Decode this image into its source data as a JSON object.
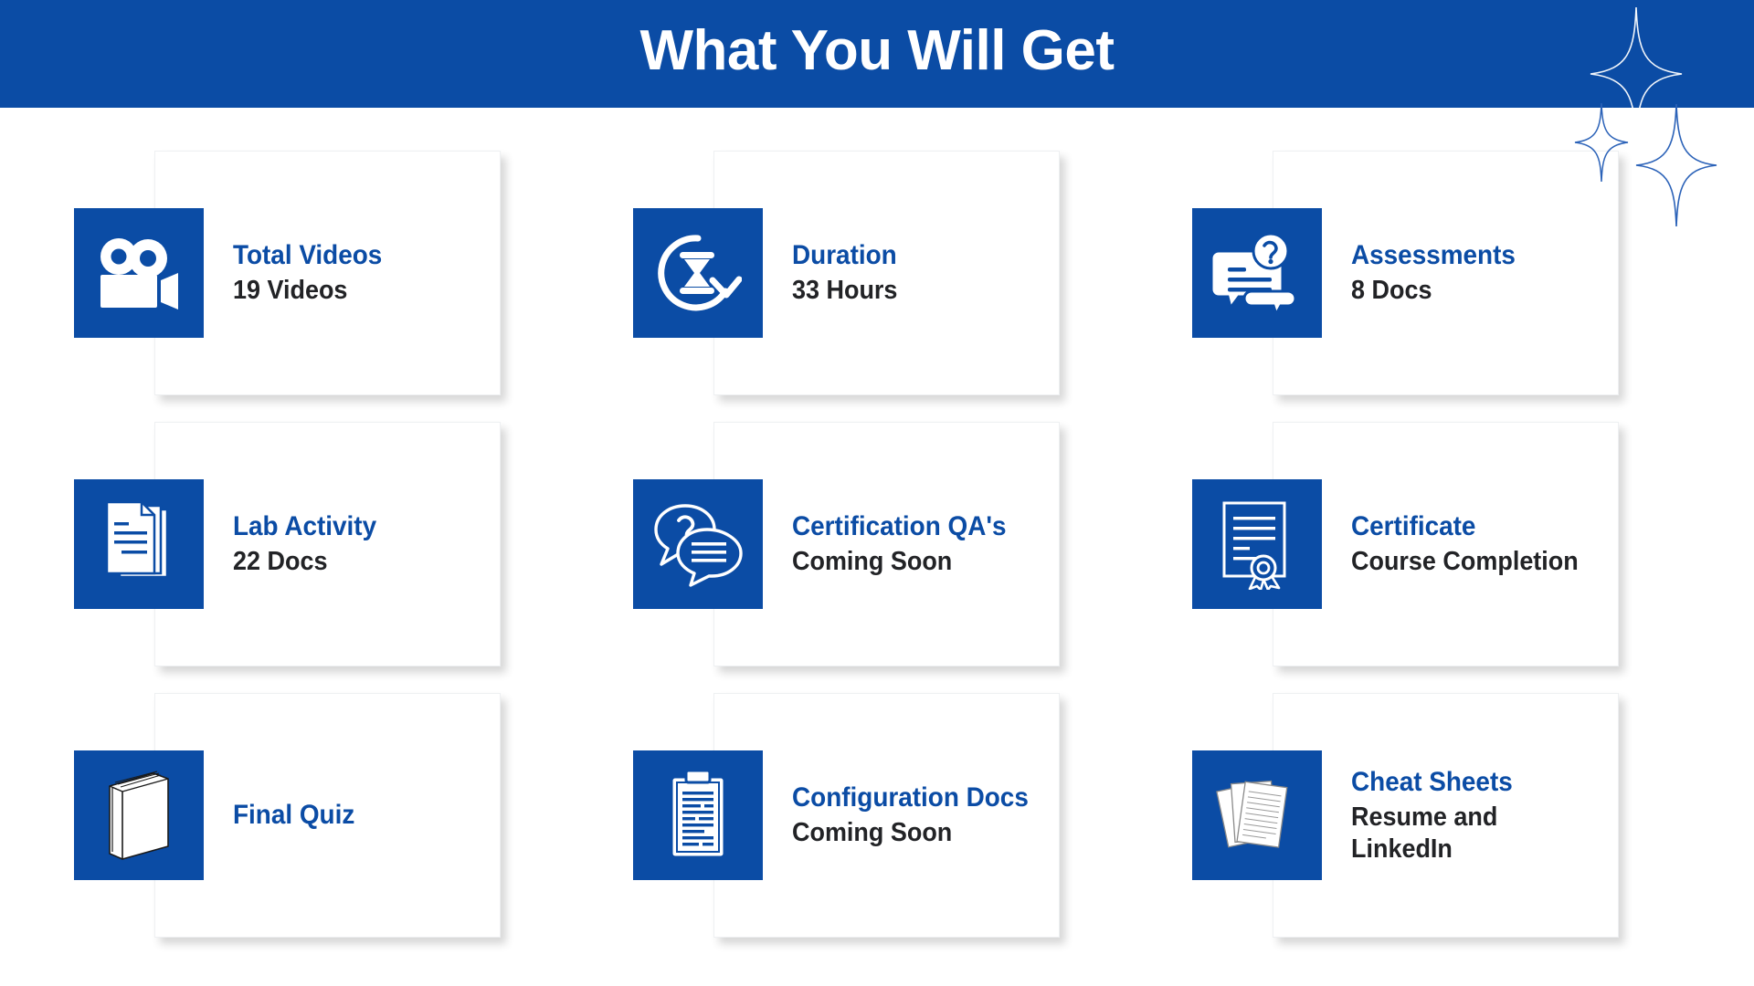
{
  "header": {
    "title": "What You Will Get",
    "background_color": "#0B4CA5",
    "text_color": "#FFFFFF"
  },
  "theme": {
    "brand_blue": "#0B4CA5",
    "card_background": "#FFFFFF",
    "subtitle_color": "#222326",
    "page_background": "#FFFFFF"
  },
  "decoration": {
    "sparkle_name": "four-point-star-sparkle",
    "sparkle_count": 3
  },
  "cards": [
    {
      "icon": "video-camera-icon",
      "title": "Total Videos",
      "subtitle": "19 Videos"
    },
    {
      "icon": "hourglass-rotate-icon",
      "title": "Duration",
      "subtitle": "33 Hours"
    },
    {
      "icon": "question-chat-document-icon",
      "title": "Assessments",
      "subtitle": "8 Docs"
    },
    {
      "icon": "stacked-documents-icon",
      "title": "Lab Activity",
      "subtitle": "22 Docs"
    },
    {
      "icon": "chat-bubbles-question-icon",
      "title": "Certification QA's",
      "subtitle": "Coming Soon"
    },
    {
      "icon": "certificate-ribbon-icon",
      "title": "Certificate",
      "subtitle": "Course Completion"
    },
    {
      "icon": "book-icon",
      "title": "Final Quiz",
      "subtitle": ""
    },
    {
      "icon": "clipboard-document-icon",
      "title": "Configuration Docs",
      "subtitle": "Coming Soon"
    },
    {
      "icon": "paper-sheets-icon",
      "title": "Cheat Sheets",
      "subtitle": "Resume and\nLinkedIn"
    }
  ]
}
